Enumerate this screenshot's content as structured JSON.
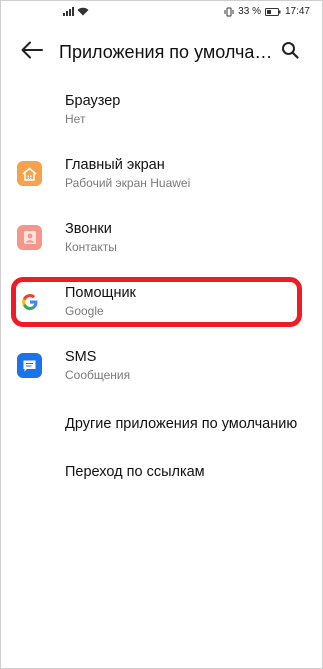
{
  "status_bar": {
    "battery_percent": "33 %",
    "time": "17:47"
  },
  "header": {
    "title": "Приложения по умолча…"
  },
  "items": [
    {
      "title": "Браузер",
      "subtitle": "Нет",
      "icon": "none"
    },
    {
      "title": "Главный экран",
      "subtitle": "Рабочий экран Huawei",
      "icon": "home-icon",
      "icon_color": "#f4a24c"
    },
    {
      "title": "Звонки",
      "subtitle": "Контакты",
      "icon": "contact-icon",
      "icon_color": "#f5968a"
    },
    {
      "title": "Помощник",
      "subtitle": "Google",
      "icon": "google-icon"
    },
    {
      "title": "SMS",
      "subtitle": "Сообщения",
      "icon": "message-icon",
      "icon_color": "#1a73e8"
    },
    {
      "title": "Другие приложения по умолчанию"
    },
    {
      "title": "Переход по ссылкам"
    }
  ],
  "highlight_color": "#ee1d25"
}
